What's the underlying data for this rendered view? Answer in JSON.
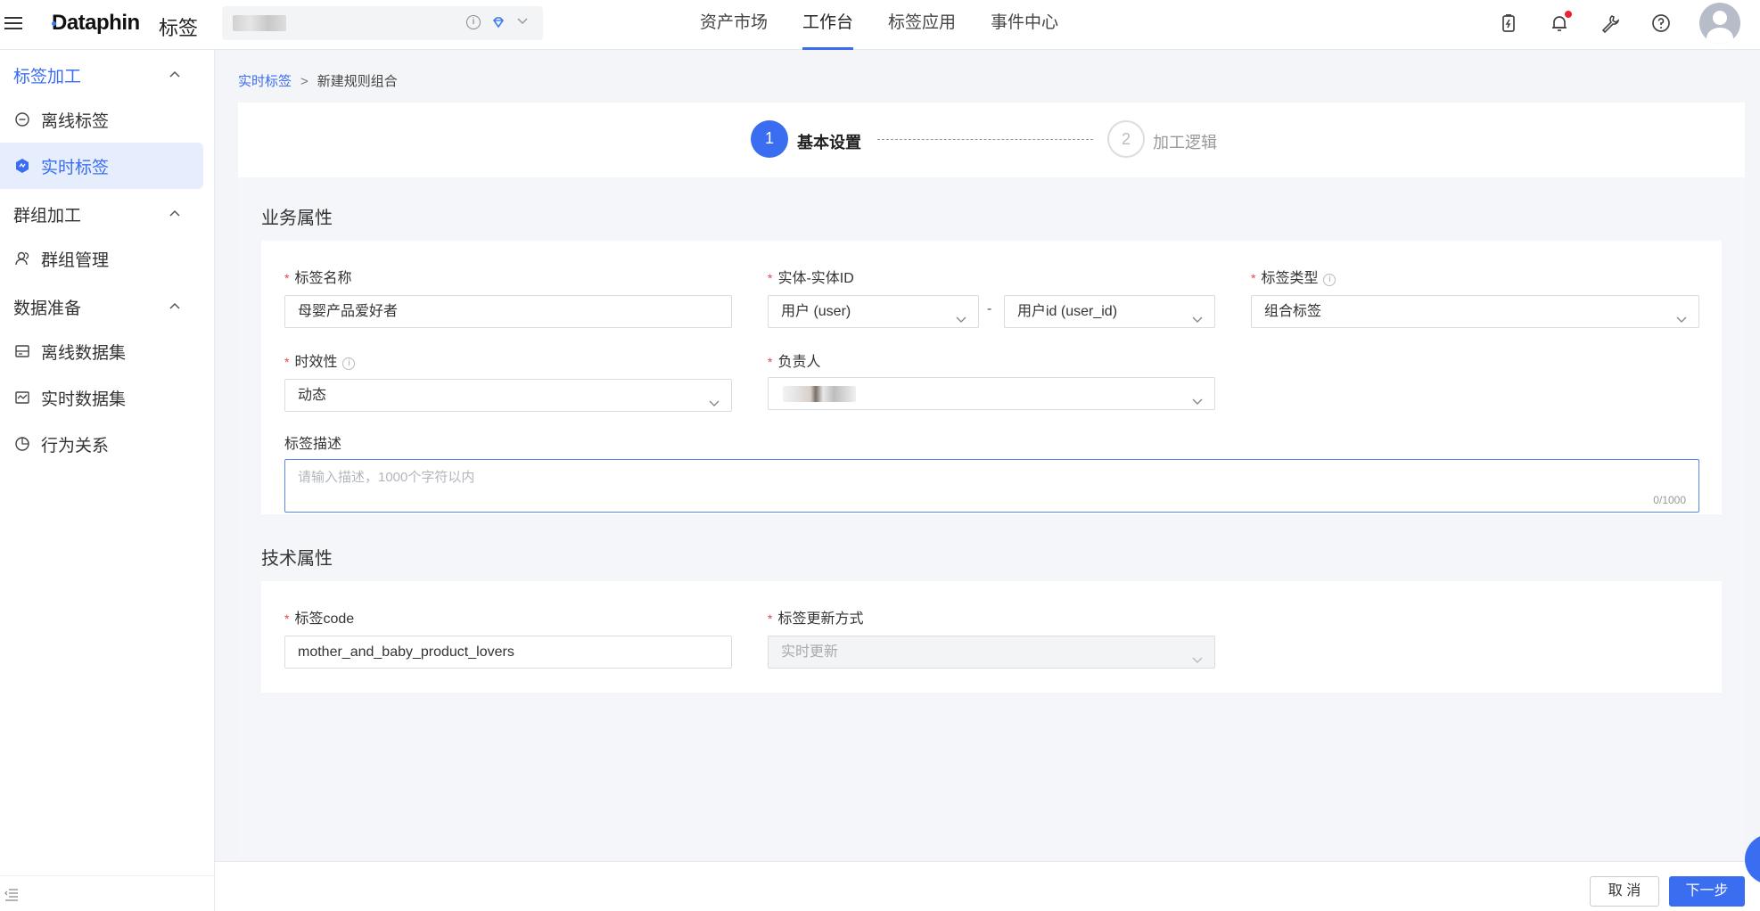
{
  "topbar": {
    "brand": "Dataphin",
    "app_name": "标签",
    "nav": [
      {
        "label": "资产市场"
      },
      {
        "label": "工作台"
      },
      {
        "label": "标签应用"
      },
      {
        "label": "事件中心"
      }
    ],
    "active_nav": "工作台",
    "icons": [
      "charge-icon",
      "bell-icon",
      "wrench-icon",
      "help-icon",
      "avatar"
    ]
  },
  "sidebar": {
    "groups": [
      {
        "label": "标签加工",
        "items": [
          {
            "label": "离线标签"
          },
          {
            "label": "实时标签"
          }
        ]
      },
      {
        "label": "群组加工",
        "items": [
          {
            "label": "群组管理"
          }
        ]
      },
      {
        "label": "数据准备",
        "items": [
          {
            "label": "离线数据集"
          },
          {
            "label": "实时数据集"
          },
          {
            "label": "行为关系"
          }
        ]
      }
    ],
    "active_item": "实时标签"
  },
  "breadcrumb": {
    "parent": "实时标签",
    "separator": ">",
    "current": "新建规则组合"
  },
  "steps": [
    {
      "number": "1",
      "label": "基本设置"
    },
    {
      "number": "2",
      "label": "加工逻辑"
    }
  ],
  "business": {
    "title": "业务属性",
    "tag_name": {
      "label": "标签名称",
      "value": "母婴产品爱好者"
    },
    "entity": {
      "label": "实体-实体ID",
      "entity_value": "用户 (user)",
      "separator": "-",
      "id_value": "用户id (user_id)"
    },
    "tag_type": {
      "label": "标签类型",
      "value": "组合标签"
    },
    "timeliness": {
      "label": "时效性",
      "value": "动态"
    },
    "owner": {
      "label": "负责人"
    },
    "description": {
      "label": "标签描述",
      "placeholder": "请输入描述，1000个字符以内",
      "count": "0/1000"
    }
  },
  "technical": {
    "title": "技术属性",
    "tag_code": {
      "label": "标签code",
      "value": "mother_and_baby_product_lovers"
    },
    "update_mode": {
      "label": "标签更新方式",
      "value": "实时更新"
    }
  },
  "footer": {
    "cancel": "取 消",
    "next": "下一步"
  },
  "colors": {
    "accent": "#3a6df0",
    "required": "#e5484d"
  }
}
